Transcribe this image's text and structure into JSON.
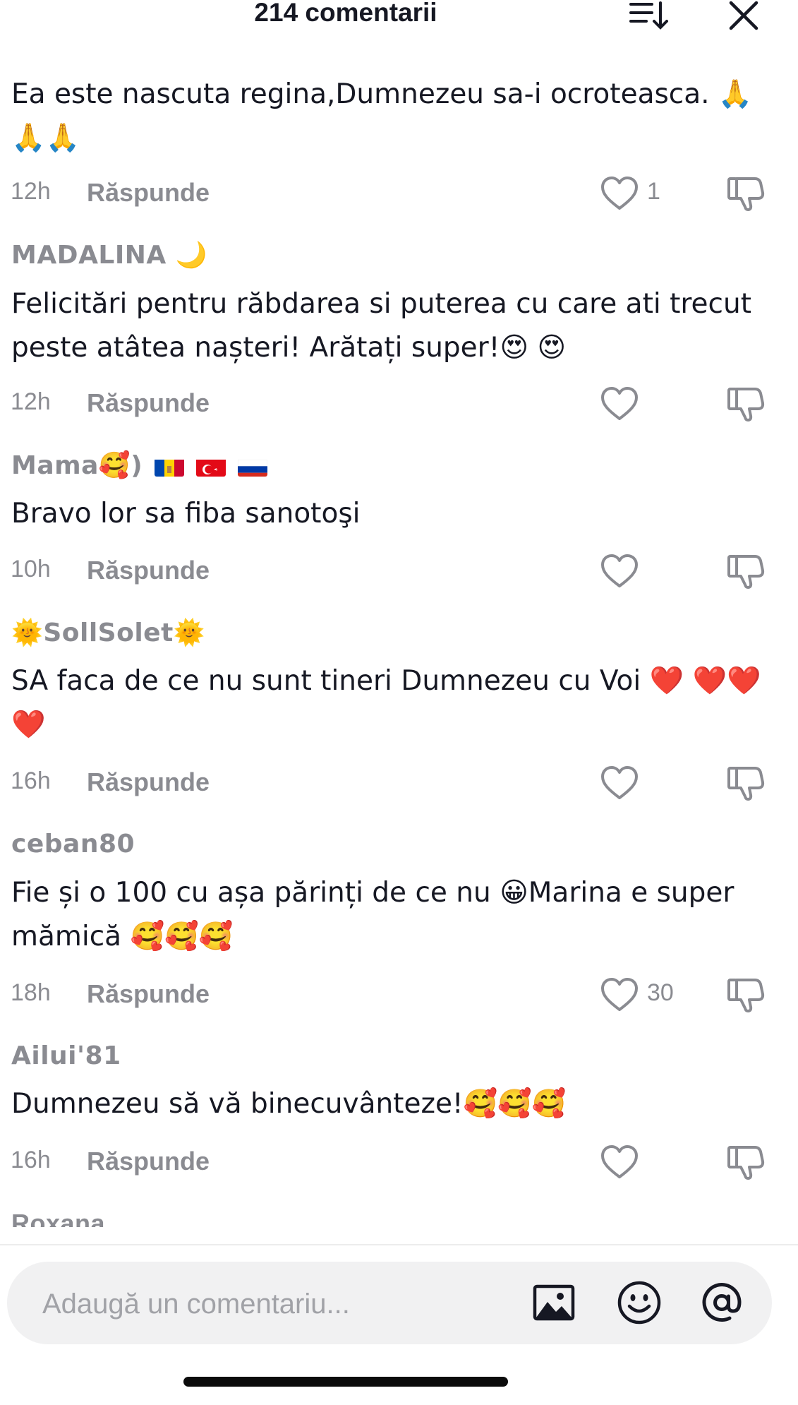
{
  "header": {
    "title": "214 comentarii",
    "sort_icon": "sort-descending-icon",
    "close_icon": "close-icon"
  },
  "comments": [
    {
      "username": "",
      "text": "Ea este nascuta regina,Dumnezeu sa-i ocroteasca. 🙏🙏🙏",
      "time": "12h",
      "reply": "Răspunde",
      "likes": "1"
    },
    {
      "username": "MADALINA 🌙",
      "text": "Felicitări pentru răbdarea si puterea cu care ati trecut peste atâtea nașteri! Arătați super!😍 😍",
      "time": "12h",
      "reply": "Răspunde",
      "likes": ""
    },
    {
      "username": "Mama🥰)",
      "flags": [
        "moldova-flag",
        "turkey-flag",
        "russia-flag"
      ],
      "text": "Bravo lor sa fiba sanotoşi",
      "time": "10h",
      "reply": "Răspunde",
      "likes": ""
    },
    {
      "username": "🌞SollSolet🌞",
      "text": "SA faca de ce nu sunt tineri Dumnezeu cu Voi ❤️ ❤️❤️❤️",
      "time": "16h",
      "reply": "Răspunde",
      "likes": ""
    },
    {
      "username": "ceban80",
      "text": "Fie și o 100 cu așa părinți de ce nu 😀Marina e super mămică 🥰🥰🥰",
      "time": "18h",
      "reply": "Răspunde",
      "likes": "30"
    },
    {
      "username": "Ailui'81",
      "text": "Dumnezeu să vă binecuvânteze!🥰🥰🥰",
      "time": "16h",
      "reply": "Răspunde",
      "likes": ""
    },
    {
      "username": "Roxana"
    }
  ],
  "composer": {
    "placeholder": "Adaugă un comentariu...",
    "icons": [
      "image-icon",
      "emoji-icon",
      "mention-icon"
    ]
  },
  "colors": {
    "text": "#161823",
    "muted": "#8a8b91",
    "input_bg": "#f1f1f2"
  }
}
